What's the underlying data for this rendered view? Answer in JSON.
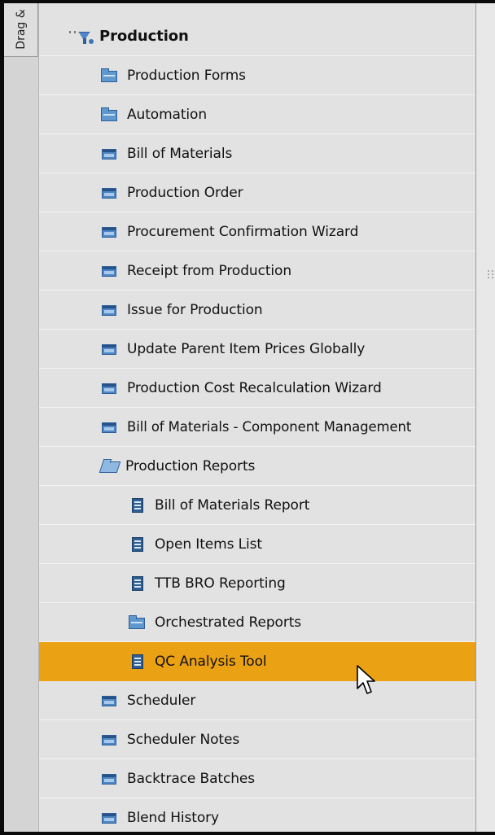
{
  "panel": {
    "drag_tab_label": "Drag &"
  },
  "tree": {
    "items": [
      {
        "label": "Production",
        "icon": "production-icon",
        "kind": "header"
      },
      {
        "label": "Production Forms",
        "icon": "folder-icon"
      },
      {
        "label": "Automation",
        "icon": "folder-icon"
      },
      {
        "label": "Bill of Materials",
        "icon": "window-icon"
      },
      {
        "label": "Production Order",
        "icon": "window-icon"
      },
      {
        "label": "Procurement Confirmation Wizard",
        "icon": "window-icon"
      },
      {
        "label": "Receipt from Production",
        "icon": "window-icon"
      },
      {
        "label": "Issue for Production",
        "icon": "window-icon"
      },
      {
        "label": "Update Parent Item Prices Globally",
        "icon": "window-icon"
      },
      {
        "label": "Production Cost Recalculation Wizard",
        "icon": "window-icon"
      },
      {
        "label": "Bill of Materials - Component Management",
        "icon": "window-icon"
      },
      {
        "label": "Production Reports",
        "icon": "folder-open-icon"
      },
      {
        "label": "Bill of Materials Report",
        "icon": "report-icon"
      },
      {
        "label": "Open Items List",
        "icon": "report-icon"
      },
      {
        "label": "TTB BRO Reporting",
        "icon": "report-icon"
      },
      {
        "label": "Orchestrated Reports",
        "icon": "folder-icon"
      },
      {
        "label": "QC Analysis Tool",
        "icon": "report-icon",
        "selected": true
      },
      {
        "label": "Scheduler",
        "icon": "window-icon"
      },
      {
        "label": "Scheduler Notes",
        "icon": "window-icon"
      },
      {
        "label": "Backtrace Batches",
        "icon": "window-icon"
      },
      {
        "label": "Blend History",
        "icon": "window-icon"
      }
    ]
  },
  "colors": {
    "selected_row": "#eba114",
    "panel_background": "#e2e2e2",
    "icon_blue": "#4f87c4"
  }
}
